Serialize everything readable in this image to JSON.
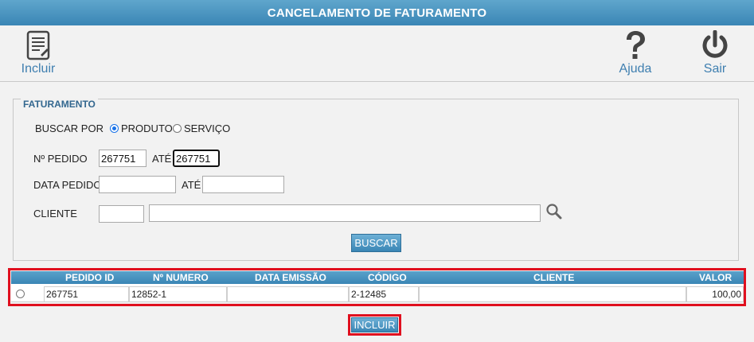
{
  "window": {
    "title": "CANCELAMENTO DE FATURAMENTO"
  },
  "toolbar": {
    "incluir_label": "Incluir",
    "ajuda_label": "Ajuda",
    "sair_label": "Sair"
  },
  "form": {
    "legend": "FATURAMENTO",
    "buscar_por_label": "BUSCAR POR",
    "radio_produto_label": "PRODUTO",
    "radio_servico_label": "SERVIÇO",
    "selected": "PRODUTO",
    "pedido_label": "Nº PEDIDO",
    "pedido_from": "267751",
    "ate_label_1": "ATÉ",
    "pedido_to": "267751",
    "data_label": "DATA PEDIDO",
    "data_from": "",
    "ate_label_2": "ATÉ",
    "data_to": "",
    "cliente_label": "CLIENTE",
    "cliente_code": "",
    "cliente_name": "",
    "buscar_button": "BUSCAR"
  },
  "grid": {
    "columns": [
      "PEDIDO ID",
      "Nº NUMERO",
      "DATA EMISSÃO",
      "CÓDIGO",
      "CLIENTE",
      "VALOR"
    ],
    "rows": [
      {
        "pedido_id": "267751",
        "numero": "12852-1",
        "data_emissao": "",
        "codigo": "2-12485",
        "cliente": "",
        "valor": "100,00"
      }
    ]
  },
  "actions": {
    "incluir_button": "INCLUIR"
  },
  "colors": {
    "header_blue": "#3a86b5",
    "label_blue": "#3f7fb0",
    "highlight_red": "#e0101f"
  }
}
